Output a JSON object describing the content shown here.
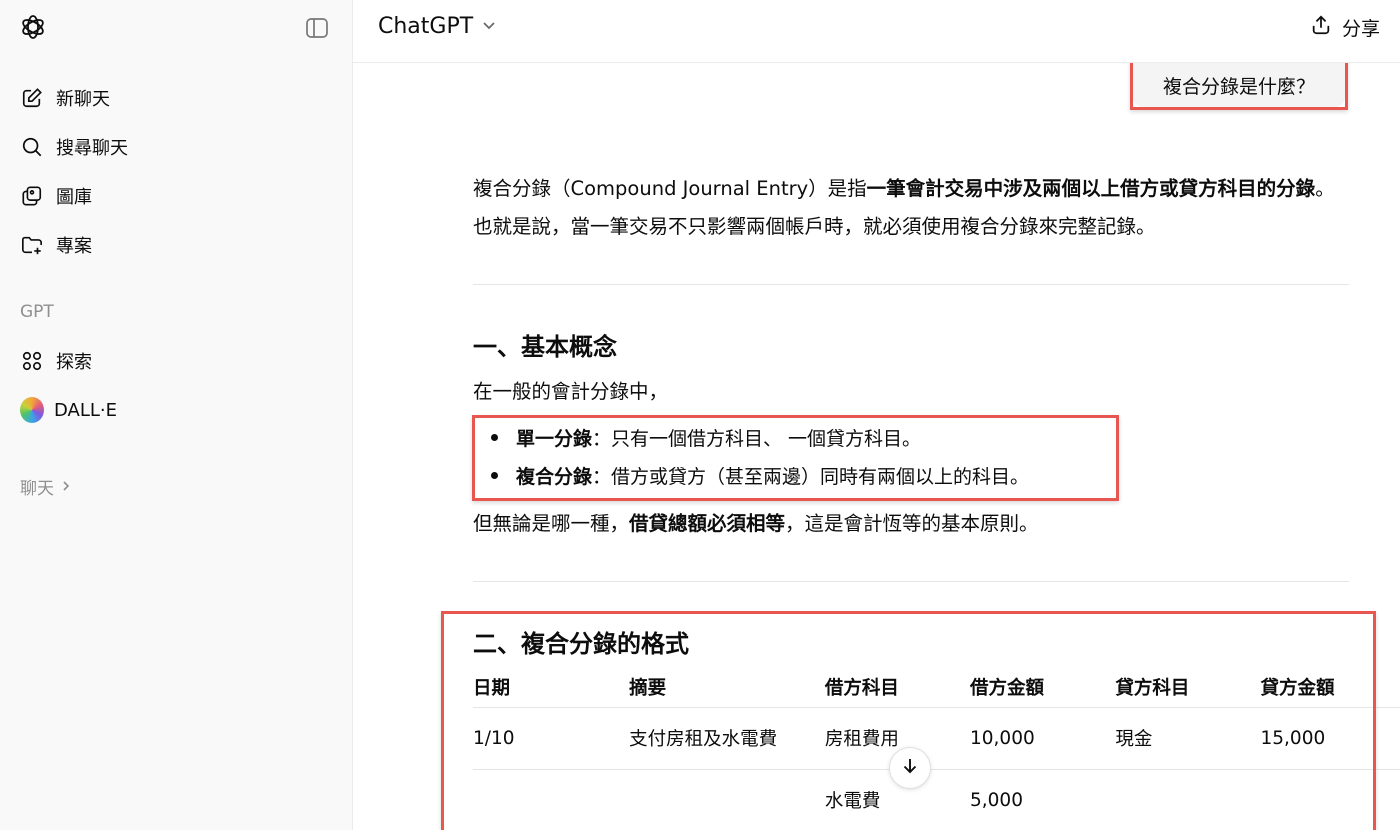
{
  "sidebar": {
    "items": [
      {
        "label": "新聊天",
        "icon": "edit-icon"
      },
      {
        "label": "搜尋聊天",
        "icon": "search-icon"
      },
      {
        "label": "圖庫",
        "icon": "gallery-icon"
      },
      {
        "label": "專案",
        "icon": "folder-plus-icon"
      }
    ],
    "gpt_section_label": "GPT",
    "gpt_items": [
      {
        "label": "探索",
        "icon": "grid-icon"
      },
      {
        "label": "DALL·E",
        "icon": "dalle-avatar"
      }
    ],
    "chats_label": "聊天"
  },
  "header": {
    "model_name": "ChatGPT",
    "share_label": "分享"
  },
  "conversation": {
    "user_message": "複合分錄是什麼？",
    "intro_part1": "複合分錄（Compound Journal Entry）是指",
    "intro_bold": "一筆會計交易中涉及兩個以上借方或貸方科目的分錄",
    "intro_part2": "。也就是說，當一筆交易不只影響兩個帳戶時，就必須使用複合分錄來完整記錄。",
    "section1_title": "一、基本概念",
    "section1_lead": "在一般的會計分錄中，",
    "bullets": [
      {
        "bold": "單一分錄",
        "text": "：只有一個借方科目、 一個貸方科目。"
      },
      {
        "bold": "複合分錄",
        "text": "：借方或貸方（甚至兩邊）同時有兩個以上的科目。"
      }
    ],
    "section1_tail_part1": "但無論是哪一種，",
    "section1_tail_bold": "借貸總額必須相等",
    "section1_tail_part2": "，這是會計恆等的基本原則。",
    "section2_title": "二、複合分錄的格式",
    "table": {
      "headers": [
        "日期",
        "摘要",
        "借方科目",
        "借方金額",
        "貸方科目",
        "貸方金額"
      ],
      "rows": [
        [
          "1/10",
          "支付房租及水電費",
          "房租費用",
          "10,000",
          "現金",
          "15,000"
        ],
        [
          "",
          "",
          "水電費",
          "5,000",
          "",
          ""
        ]
      ]
    }
  },
  "colors": {
    "highlight": "#e8574f",
    "sidebar_bg": "#f9f9f9"
  }
}
